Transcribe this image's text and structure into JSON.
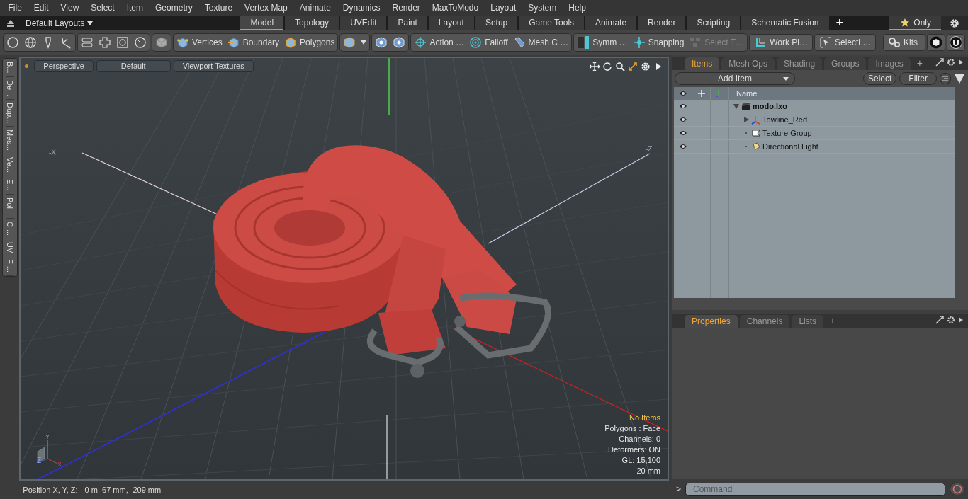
{
  "menu": [
    "File",
    "Edit",
    "View",
    "Select",
    "Item",
    "Geometry",
    "Texture",
    "Vertex Map",
    "Animate",
    "Dynamics",
    "Render",
    "MaxToModo",
    "Layout",
    "System",
    "Help"
  ],
  "layout_bar": {
    "layouts": "Default Layouts",
    "tabs": [
      {
        "label": "Model",
        "selected": true
      },
      {
        "label": "Topology",
        "selected": false
      },
      {
        "label": "UVEdit",
        "selected": false
      },
      {
        "label": "Paint",
        "selected": false
      },
      {
        "label": "Layout",
        "selected": false
      },
      {
        "label": "Setup",
        "selected": false
      },
      {
        "label": "Game Tools",
        "selected": false
      },
      {
        "label": "Animate",
        "selected": false
      },
      {
        "label": "Render",
        "selected": false
      },
      {
        "label": "Scripting",
        "selected": false
      },
      {
        "label": "Schematic Fusion",
        "selected": false
      }
    ],
    "add": "+",
    "only": "Only"
  },
  "toolbar": [
    {
      "label": "Vertices",
      "kind": "vertices",
      "disabled": false
    },
    {
      "label": "Boundary",
      "kind": "boundary",
      "disabled": false
    },
    {
      "label": "Polygons",
      "kind": "polygons",
      "disabled": false
    },
    {
      "label": "Action …",
      "kind": "action",
      "disabled": false
    },
    {
      "label": "Falloff",
      "kind": "falloff",
      "disabled": false
    },
    {
      "label": "Mesh C …",
      "kind": "mesh",
      "disabled": false
    },
    {
      "label": "Symm …",
      "kind": "symmetry",
      "disabled": false
    },
    {
      "label": "Snapping",
      "kind": "snapping",
      "disabled": false
    },
    {
      "label": "Select T…",
      "kind": "select",
      "disabled": true
    },
    {
      "label": "Work Pl…",
      "kind": "workplane",
      "disabled": false
    },
    {
      "label": "Selecti …",
      "kind": "selection",
      "disabled": false
    },
    {
      "label": "Kits",
      "kind": "kits",
      "disabled": false
    }
  ],
  "side_tabs": [
    "B...",
    "De...",
    "Dup...",
    "Mes...",
    "Ve...",
    "E...",
    "Pol...",
    "C ...",
    "UV",
    "F ..."
  ],
  "viewport": {
    "buttons": [
      "Perspective",
      "Default",
      "Viewport Textures"
    ],
    "axis_labels": [
      "-X",
      "-Z"
    ],
    "gizmo_labels": [
      "Y",
      "X",
      "Z"
    ],
    "info": [
      {
        "text": "No Items",
        "kind": "highlight"
      },
      {
        "text": "Polygons : Face",
        "kind": "plain"
      },
      {
        "text": "Channels: 0",
        "kind": "plain"
      },
      {
        "text": "Deformers: ON",
        "kind": "plain"
      },
      {
        "text": "GL: 15,100",
        "kind": "plain"
      },
      {
        "text": "20 mm",
        "kind": "plain"
      }
    ]
  },
  "items_panel": {
    "tabs": [
      {
        "label": "Items",
        "selected": true
      },
      {
        "label": "Mesh Ops",
        "selected": false
      },
      {
        "label": "Shading",
        "selected": false
      },
      {
        "label": "Groups",
        "selected": false
      },
      {
        "label": "Images",
        "selected": false
      }
    ],
    "add_tab": "+",
    "add_item": "Add Item",
    "select": "Select",
    "filter": "Filter",
    "column": "Name",
    "tree": [
      {
        "name": "modo.lxo",
        "kind": "scene",
        "expanded": true,
        "children": [
          {
            "name": "Towline_Red",
            "kind": "mesh",
            "expanded": false
          },
          {
            "name": "Texture Group",
            "kind": "texture"
          },
          {
            "name": "Directional Light",
            "kind": "light"
          }
        ]
      }
    ]
  },
  "properties_panel": {
    "tabs": [
      {
        "label": "Properties",
        "selected": true
      },
      {
        "label": "Channels",
        "selected": false
      },
      {
        "label": "Lists",
        "selected": false
      }
    ],
    "add_tab": "+"
  },
  "command": {
    "prompt": ">",
    "placeholder": "Command"
  },
  "status_bar": {
    "label": "Position X, Y, Z:",
    "value": "0 m, 67 mm, -209 mm"
  }
}
